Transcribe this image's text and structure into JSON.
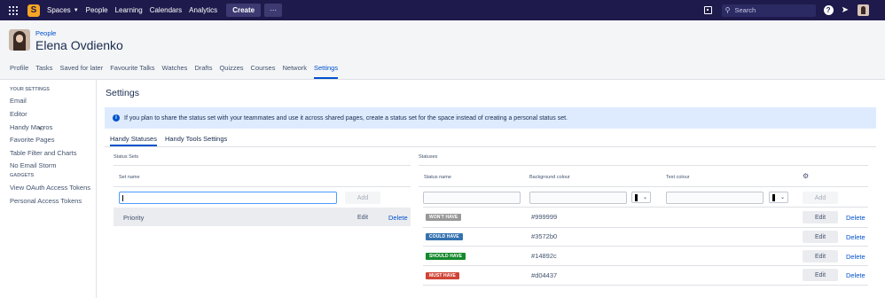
{
  "topnav": {
    "logo_letter": "S",
    "items": [
      {
        "label": "Spaces",
        "dropdown": true
      },
      {
        "label": "People"
      },
      {
        "label": "Learning"
      },
      {
        "label": "Calendars"
      },
      {
        "label": "Analytics"
      }
    ],
    "create_label": "Create",
    "more_label": "···",
    "search_placeholder": "Search",
    "help_label": "?"
  },
  "profile": {
    "breadcrumb": "People",
    "name": "Elena Ovdienko",
    "tabs": [
      "Profile",
      "Tasks",
      "Saved for later",
      "Favourite Talks",
      "Watches",
      "Drafts",
      "Quizzes",
      "Courses",
      "Network",
      "Settings"
    ],
    "active_tab": "Settings"
  },
  "sidebar": {
    "your_settings_heading": "YOUR SETTINGS",
    "items": [
      "Email",
      "Editor",
      "Handy Macros",
      "Favorite Pages",
      "Table Filter and Charts",
      "No Email Storm"
    ],
    "gadgets_heading": "GADGETS",
    "gadget_items": [
      "View OAuth Access Tokens",
      "Personal Access Tokens"
    ]
  },
  "main": {
    "title": "Settings",
    "info": "If you plan to share the status set with your teammates and use it across shared pages, create a status set for the space instead of creating a personal status set.",
    "subtabs": [
      "Handy Statuses",
      "Handy Tools Settings"
    ],
    "active_subtab": "Handy Statuses",
    "status_sets": {
      "section_label": "Status Sets",
      "col_set_name": "Set name",
      "new_value": "",
      "add_label": "Add",
      "rows": [
        {
          "name": "Priority",
          "edit_label": "Edit",
          "delete_label": "Delete"
        }
      ]
    },
    "statuses": {
      "section_label": "Statuses",
      "col_status_name": "Status name",
      "col_background": "Background colour",
      "col_text": "Text colour",
      "add_label": "Add",
      "rows": [
        {
          "badge": "WON'T HAVE",
          "hex": "#999999",
          "color": "#999999",
          "edit_label": "Edit",
          "delete_label": "Delete"
        },
        {
          "badge": "COULD HAVE",
          "hex": "#3572b0",
          "color": "#3572b0",
          "edit_label": "Edit",
          "delete_label": "Delete"
        },
        {
          "badge": "SHOULD HAVE",
          "hex": "#14892c",
          "color": "#14892c",
          "edit_label": "Edit",
          "delete_label": "Delete"
        },
        {
          "badge": "MUST HAVE",
          "hex": "#d04437",
          "color": "#d04437",
          "edit_label": "Edit",
          "delete_label": "Delete"
        }
      ]
    }
  },
  "colors": {
    "nav_bg": "#1e1a4b",
    "accent": "#0052cc",
    "info_bg": "#deebff"
  }
}
